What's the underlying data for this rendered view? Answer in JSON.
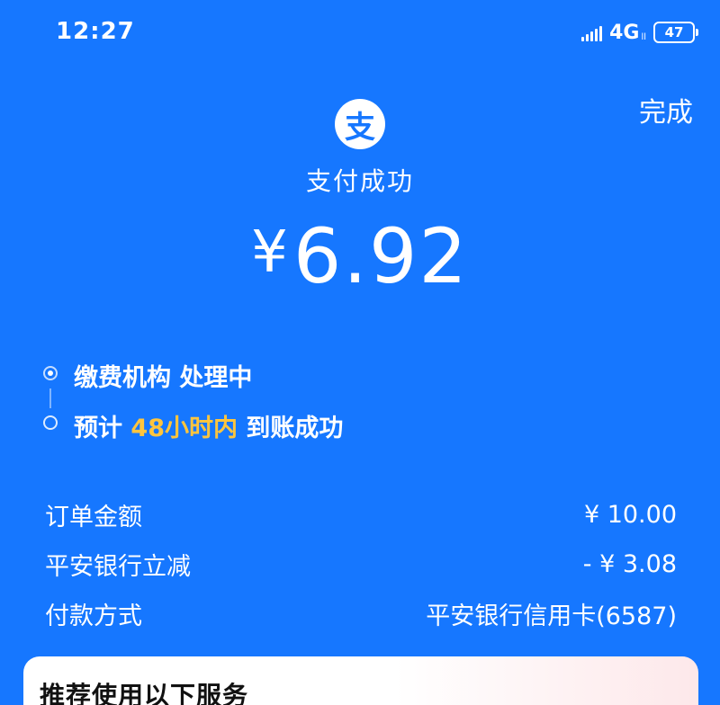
{
  "status_bar": {
    "time": "12:27",
    "network_type": "4G",
    "network_sub": "ll",
    "battery": "47"
  },
  "header": {
    "done_label": "完成",
    "logo_char": "支"
  },
  "payment": {
    "status": "支付成功",
    "currency": "¥",
    "amount": "6.92"
  },
  "timeline": {
    "step1": "缴费机构 处理中",
    "step2_prefix": "预计 ",
    "step2_highlight": "48小时内",
    "step2_suffix": " 到账成功"
  },
  "details": [
    {
      "label": "订单金额",
      "value": "¥ 10.00"
    },
    {
      "label": "平安银行立减",
      "value": "- ¥ 3.08"
    },
    {
      "label": "付款方式",
      "value": "平安银行信用卡(6587)"
    }
  ],
  "services": {
    "title": "推荐使用以下服务"
  },
  "colors": {
    "background": "#1677ff",
    "highlight": "#ffc53d"
  }
}
